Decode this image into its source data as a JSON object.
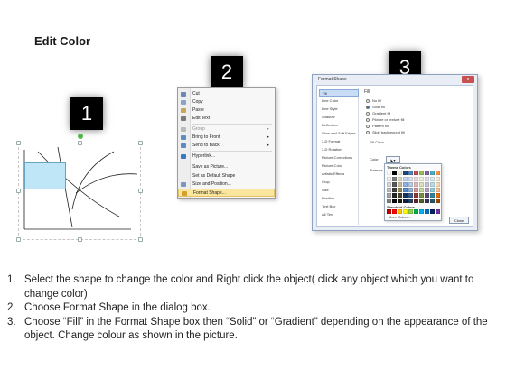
{
  "title": "Edit Color",
  "steps": [
    "1",
    "2",
    "3"
  ],
  "context_menu": {
    "items": [
      {
        "label": "Cut",
        "enabled": true,
        "icon": "scissors-icon"
      },
      {
        "label": "Copy",
        "enabled": true,
        "icon": "copy-icon"
      },
      {
        "label": "Paste",
        "enabled": true,
        "icon": "paste-icon"
      },
      {
        "label": "Edit Text",
        "enabled": true,
        "icon": "edit-text-icon"
      },
      {
        "label": "Group",
        "enabled": false,
        "icon": "group-icon",
        "submenu": true
      },
      {
        "label": "Bring to Front",
        "enabled": true,
        "icon": "bring-front-icon",
        "submenu": true
      },
      {
        "label": "Send to Back",
        "enabled": true,
        "icon": "send-back-icon",
        "submenu": true
      },
      {
        "label": "Hyperlink...",
        "enabled": true,
        "icon": "hyperlink-icon"
      },
      {
        "label": "Save as Picture...",
        "enabled": true,
        "icon": ""
      },
      {
        "label": "Set as Default Shape",
        "enabled": true,
        "icon": ""
      },
      {
        "label": "Size and Position...",
        "enabled": true,
        "icon": "size-icon"
      },
      {
        "label": "Format Shape...",
        "enabled": true,
        "icon": "format-shape-icon",
        "highlighted": true
      }
    ]
  },
  "format_dialog": {
    "title": "Format Shape",
    "close_glyph": "x",
    "categories": [
      "Fill",
      "Line Color",
      "Line Style",
      "Shadow",
      "Reflection",
      "Glow and Soft Edges",
      "3-D Format",
      "3-D Rotation",
      "Picture Corrections",
      "Picture Color",
      "Artistic Effects",
      "Crop",
      "Size",
      "Position",
      "Text Box",
      "Alt Text"
    ],
    "selected_category": "Fill",
    "heading": "Fill",
    "options": [
      {
        "label": "No fill",
        "selected": false
      },
      {
        "label": "Solid fill",
        "selected": true
      },
      {
        "label": "Gradient fill",
        "selected": false
      },
      {
        "label": "Picture or texture fill",
        "selected": false
      },
      {
        "label": "Pattern fill",
        "selected": false
      },
      {
        "label": "Slide background fill",
        "selected": false
      }
    ],
    "fill_color_label": "Fill Color",
    "color_label": "Color:",
    "transparency_label": "Transpa",
    "palette": {
      "theme_title": "Theme Colors",
      "standard_title": "Standard Colors",
      "more_label": "More Colors...",
      "theme_top": [
        "#ffffff",
        "#000000",
        "#eeece1",
        "#1f497d",
        "#4f81bd",
        "#c0504d",
        "#9bbb59",
        "#8064a2",
        "#4bacc6",
        "#f79646"
      ],
      "theme_shades": [
        [
          "#f2f2f2",
          "#7f7f7f",
          "#ddd9c3",
          "#c6d9f0",
          "#dbe5f1",
          "#f2dcdb",
          "#ebf1dd",
          "#e5e0ec",
          "#dbeef3",
          "#fdeada"
        ],
        [
          "#d8d8d8",
          "#595959",
          "#c4bd97",
          "#8db3e2",
          "#b8cce4",
          "#e5b9b7",
          "#d7e3bc",
          "#ccc1d9",
          "#b7dde8",
          "#fbd5b5"
        ],
        [
          "#bfbfbf",
          "#3f3f3f",
          "#938953",
          "#548dd4",
          "#95b3d7",
          "#d99694",
          "#c3d69b",
          "#b2a2c7",
          "#92cddc",
          "#fac08f"
        ],
        [
          "#a5a5a5",
          "#262626",
          "#494429",
          "#17365d",
          "#366092",
          "#953734",
          "#76923c",
          "#5f497a",
          "#31859b",
          "#e36c09"
        ],
        [
          "#7f7f7f",
          "#0c0c0c",
          "#1d1b10",
          "#0f243e",
          "#244061",
          "#632423",
          "#4f6128",
          "#3f3151",
          "#205867",
          "#974806"
        ]
      ],
      "standard": [
        "#c00000",
        "#ff0000",
        "#ffc000",
        "#ffff00",
        "#92d050",
        "#00b050",
        "#00b0f0",
        "#0070c0",
        "#002060",
        "#7030a0"
      ]
    },
    "close_button": "Close"
  },
  "instructions": [
    {
      "num": "1.",
      "text": "Select the shape to change the color and Right click the object( click any object which you want to change color)"
    },
    {
      "num": "2.",
      "text": "Choose Format Shape in the dialog box."
    },
    {
      "num": "3.",
      "text": "Choose “Fill” in the Format Shape box then “Solid” or “Gradient” depending on the appearance of the object. Change colour as shown in the picture."
    }
  ]
}
